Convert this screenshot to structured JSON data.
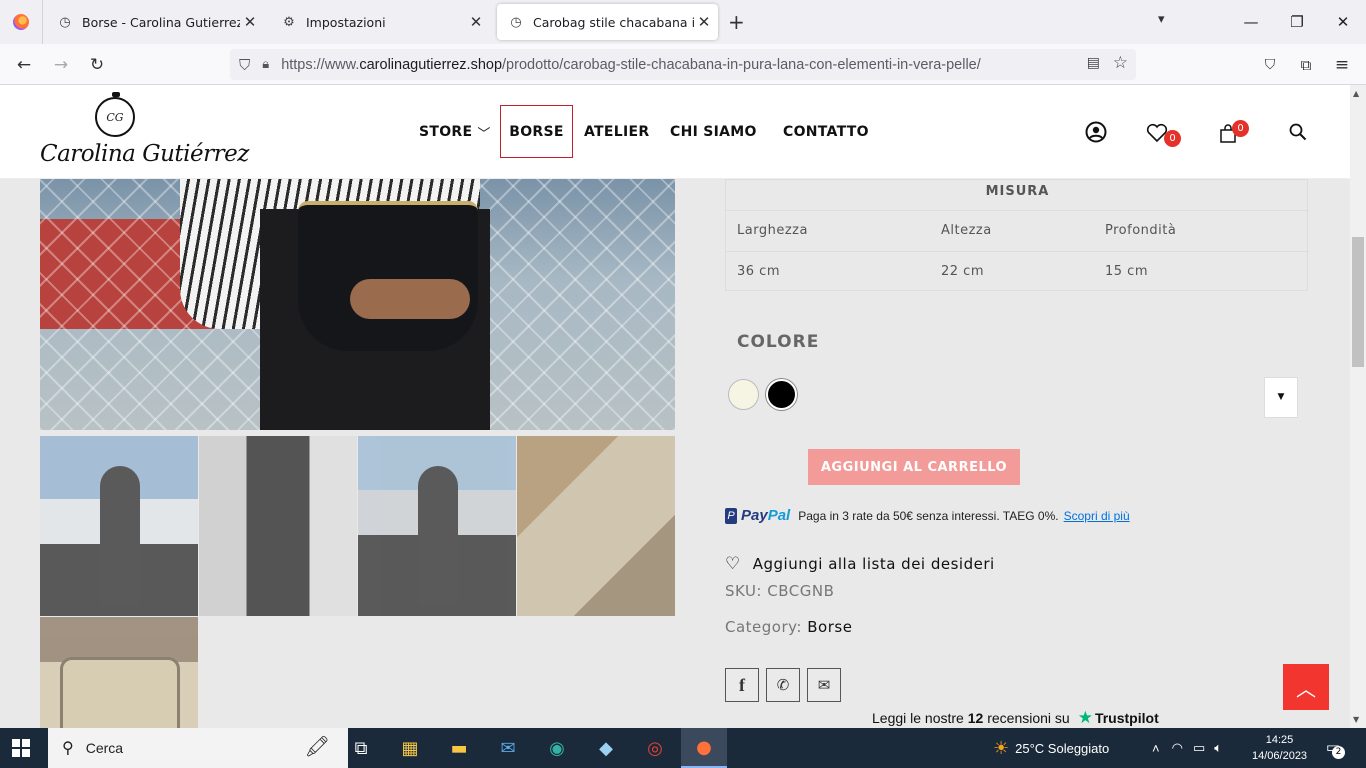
{
  "browser": {
    "tabs": [
      {
        "title": "Borse - Carolina Gutierrez Atelier",
        "icon": "site-icon"
      },
      {
        "title": "Impostazioni",
        "icon": "gear-icon"
      },
      {
        "title": "Carobag stile chacabana in pura lana",
        "icon": "site-icon",
        "active": true
      }
    ],
    "url_prefix": "https://www.",
    "url_domain": "carolinagutierrez.shop",
    "url_path": "/prodotto/carobag-stile-chacabana-in-pura-lana-con-elementi-in-vera-pelle/"
  },
  "header": {
    "logo_initials": "CG",
    "logo_name": "Carolina Gutiérrez",
    "menu": {
      "store": "STORE",
      "borse": "BORSE",
      "atelier": "ATELIER",
      "chi_siamo": "CHI SIAMO",
      "contatto": "CONTATTO"
    },
    "wishlist_count": "0",
    "cart_count": "0"
  },
  "product": {
    "misura": {
      "heading": "MISURA",
      "labels": {
        "larghezza": "Larghezza",
        "altezza": "Altezza",
        "profondita": "Profondità"
      },
      "values": {
        "larghezza": "36 cm",
        "altezza": "22 cm",
        "profondita": "15 cm"
      }
    },
    "colore_label": "COLORE",
    "colors": [
      "#f6f5e4",
      "#000000"
    ],
    "add_to_cart": "AGGIUNGI AL CARRELLO",
    "paypal": {
      "brand_pay": "Pay",
      "brand_pal": "Pal",
      "text": "Paga in 3 rate da 50€ senza interessi. TAEG 0%.",
      "link": "Scopri di più"
    },
    "wishlist_label": "Aggiungi alla lista dei desideri",
    "sku": "SKU: CBCGNB",
    "category_label": "Category:",
    "category_value": "Borse",
    "trustpilot": {
      "prefix": "Leggi le nostre",
      "count": "12",
      "suffix": "recensioni su",
      "brand": "Trustpilot"
    }
  },
  "taskbar": {
    "search_placeholder": "Cerca",
    "weather": "25°C  Soleggiato",
    "time": "14:25",
    "date": "14/06/2023",
    "notifications": "2"
  }
}
